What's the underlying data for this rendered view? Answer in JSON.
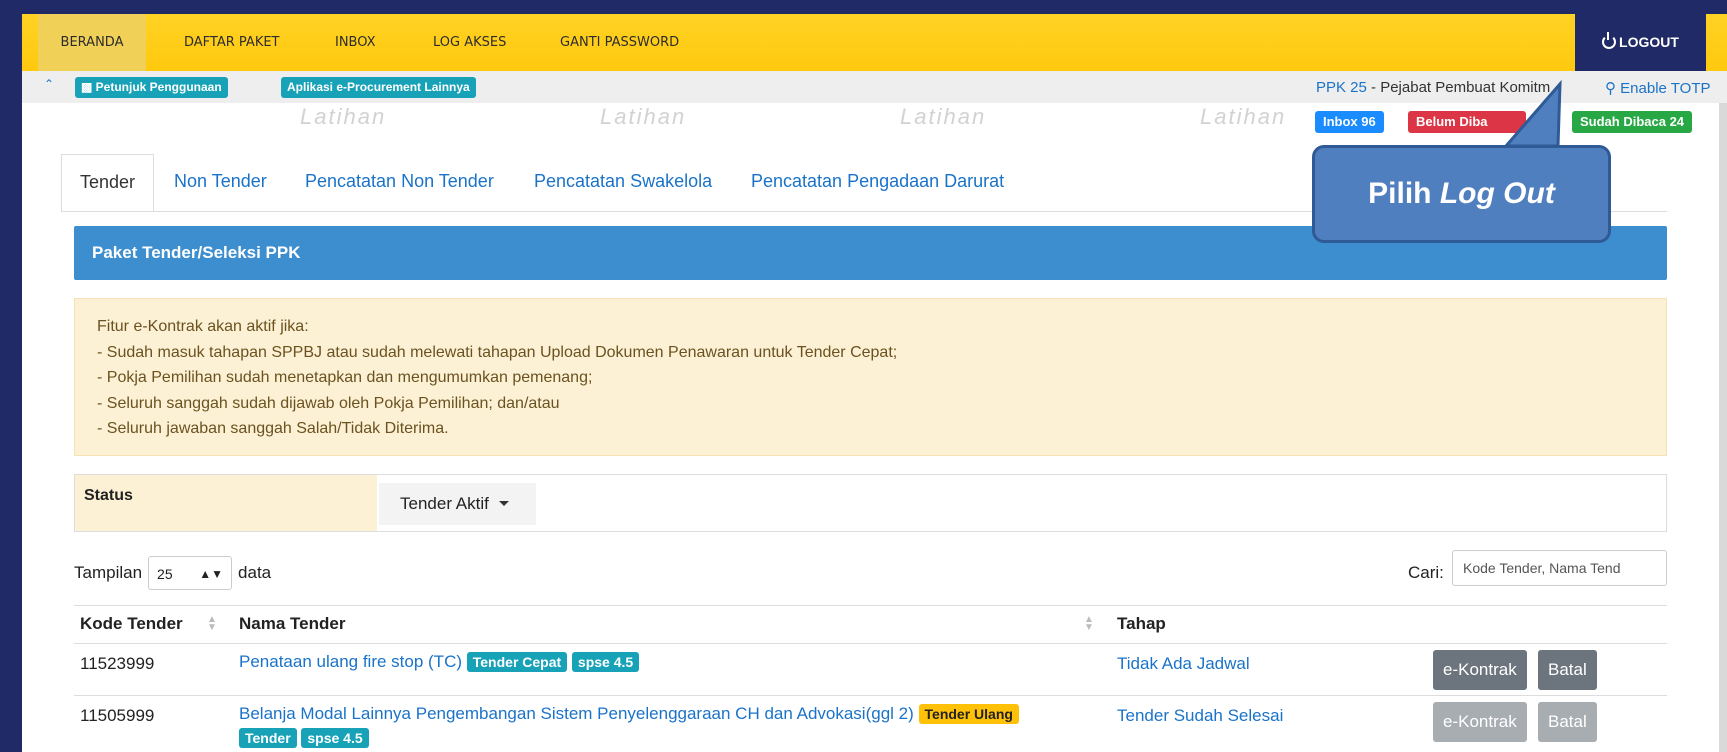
{
  "nav": {
    "items": [
      "BERANDA",
      "DAFTAR PAKET",
      "INBOX",
      "LOG AKSES",
      "GANTI PASSWORD"
    ],
    "logout": "LOGOUT"
  },
  "subbar": {
    "guide": "Petunjuk Penggunaan",
    "other_apps": "Aplikasi e-Procurement Lainnya",
    "ppk_code": "PPK 25",
    "ppk_role": " - Pejabat Pembuat Komitm",
    "totp": "Enable TOTP"
  },
  "badges": {
    "inbox": "Inbox 96",
    "unread": "Belum Diba",
    "read": "Sudah Dibaca 24"
  },
  "watermark": "Latihan",
  "tabs": [
    "Tender",
    "Non Tender",
    "Pencatatan Non Tender",
    "Pencatatan Swakelola",
    "Pencatatan Pengadaan Darurat"
  ],
  "panel_title": "Paket Tender/Seleksi PPK",
  "alert_lines": [
    "Fitur e-Kontrak akan aktif jika:",
    "- Sudah masuk tahapan SPPBJ atau sudah melewati tahapan Upload Dokumen Penawaran untuk Tender Cepat;",
    "- Pokja Pemilihan sudah menetapkan dan mengumumkan pemenang;",
    "- Seluruh sanggah sudah dijawab oleh Pokja Pemilihan; dan/atau",
    "- Seluruh jawaban sanggah Salah/Tidak Diterima."
  ],
  "status": {
    "label": "Status",
    "value": "Tender Aktif"
  },
  "table_controls": {
    "show_label": "Tampilan",
    "page_size": "25",
    "data_label": "data",
    "search_label": "Cari:",
    "search_placeholder": "Kode Tender, Nama Tend"
  },
  "table": {
    "headers": [
      "Kode Tender",
      "Nama Tender",
      "Tahap"
    ],
    "rows": [
      {
        "code": "11523999",
        "name": "Penataan ulang fire stop (TC)",
        "labels": [
          "Tender Cepat",
          "spse 4.5"
        ],
        "stage": "Tidak Ada Jadwal",
        "btn_contract": "e-Kontrak",
        "btn_cancel": "Batal"
      },
      {
        "code": "11505999",
        "name": "Belanja Modal Lainnya Pengembangan Sistem Penyelenggaraan CH dan Advokasi(ggl 2)",
        "labels": [
          "Tender Ulang",
          "Tender",
          "spse 4.5"
        ],
        "stage": "Tender Sudah Selesai",
        "btn_contract": "e-Kontrak",
        "btn_cancel": "Batal"
      }
    ]
  },
  "callout": {
    "prefix": "Pilih ",
    "emphasis": "Log Out"
  },
  "colors": {
    "nav_bg": "#ffc90e",
    "logout_bg": "#1f2a66",
    "panel_blue": "#3d8ecf",
    "link_blue": "#1a73c9",
    "badge_inbox": "#1a8cff",
    "badge_unread": "#dc3545",
    "badge_read": "#28a745",
    "callout_bg": "#4f7fbf"
  }
}
